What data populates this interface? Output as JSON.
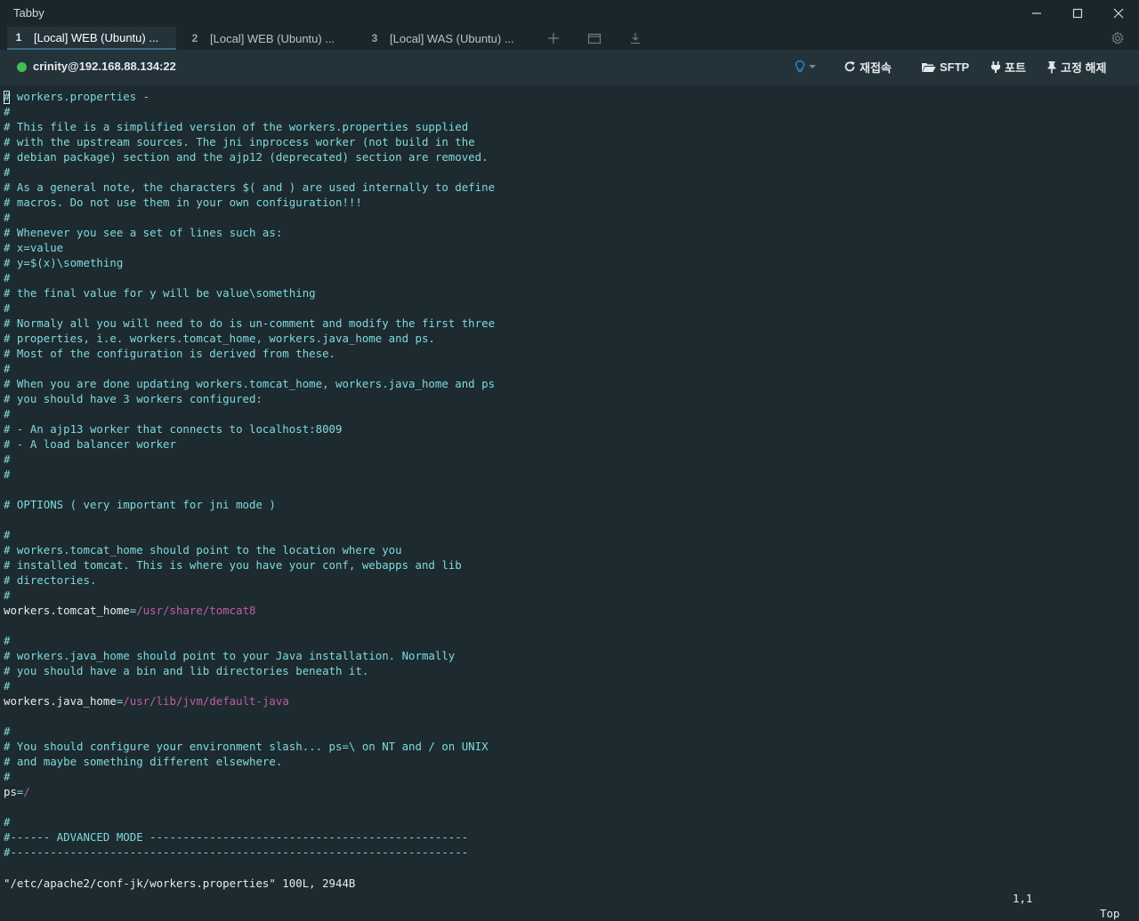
{
  "window": {
    "title": "Tabby",
    "controls": [
      "minimize-icon",
      "maximize-icon",
      "close-icon"
    ]
  },
  "tabs": [
    {
      "num": "1",
      "label": "[Local] WEB (Ubuntu) ...",
      "active": true
    },
    {
      "num": "2",
      "label": "[Local] WEB (Ubuntu) ...",
      "active": false
    },
    {
      "num": "3",
      "label": "[Local] WAS (Ubuntu) ...",
      "active": false
    }
  ],
  "tab_tools": [
    "plus-icon",
    "window-icon",
    "download-icon",
    "settings-gear-icon"
  ],
  "session": {
    "host": "crinity@192.168.88.134:22",
    "status_color": "#3fbf54",
    "reconnect_label": "재접속",
    "sftp_label": "SFTP",
    "ports_label": "포트",
    "unpin_label": "고정 해제"
  },
  "terminal": {
    "lines": [
      {
        "text": "# workers.properties -"
      },
      {
        "text": "#"
      },
      {
        "text": "# This file is a simplified version of the workers.properties supplied"
      },
      {
        "text": "# with the upstream sources. The jni inprocess worker (not build in the"
      },
      {
        "text": "# debian package) section and the ajp12 (deprecated) section are removed."
      },
      {
        "text": "#"
      },
      {
        "text": "# As a general note, the characters $( and ) are used internally to define"
      },
      {
        "text": "# macros. Do not use them in your own configuration!!!"
      },
      {
        "text": "#"
      },
      {
        "text": "# Whenever you see a set of lines such as:"
      },
      {
        "text": "# x=value"
      },
      {
        "text": "# y=$(x)\\something"
      },
      {
        "text": "#"
      },
      {
        "text": "# the final value for y will be value\\something"
      },
      {
        "text": "#"
      },
      {
        "text": "# Normaly all you will need to do is un-comment and modify the first three"
      },
      {
        "text": "# properties, i.e. workers.tomcat_home, workers.java_home and ps."
      },
      {
        "text": "# Most of the configuration is derived from these."
      },
      {
        "text": "#"
      },
      {
        "text": "# When you are done updating workers.tomcat_home, workers.java_home and ps"
      },
      {
        "text": "# you should have 3 workers configured:"
      },
      {
        "text": "#"
      },
      {
        "text": "# - An ajp13 worker that connects to localhost:8009"
      },
      {
        "text": "# - A load balancer worker"
      },
      {
        "text": "#"
      },
      {
        "text": "#"
      },
      {
        "text": ""
      },
      {
        "text": "# OPTIONS ( very important for jni mode )"
      },
      {
        "text": ""
      },
      {
        "text": "#"
      },
      {
        "text": "# workers.tomcat_home should point to the location where you"
      },
      {
        "text": "# installed tomcat. This is where you have your conf, webapps and lib"
      },
      {
        "text": "# directories."
      },
      {
        "text": "#"
      },
      {
        "key": "workers.tomcat_home",
        "eq": "=",
        "value": "/usr/share/tomcat8"
      },
      {
        "text": ""
      },
      {
        "text": "#"
      },
      {
        "text": "# workers.java_home should point to your Java installation. Normally"
      },
      {
        "text": "# you should have a bin and lib directories beneath it."
      },
      {
        "text": "#"
      },
      {
        "key": "workers.java_home",
        "eq": "=",
        "value": "/usr/lib/jvm/default-java"
      },
      {
        "text": ""
      },
      {
        "text": "#"
      },
      {
        "text": "# You should configure your environment slash... ps=\\ on NT and / on UNIX"
      },
      {
        "text": "# and maybe something different elsewhere."
      },
      {
        "text": "#"
      },
      {
        "key": "ps",
        "eq": "=",
        "value": "/"
      },
      {
        "text": ""
      },
      {
        "text": "#"
      },
      {
        "text": "#------ ADVANCED MODE ------------------------------------------------"
      },
      {
        "text": "#---------------------------------------------------------------------"
      }
    ],
    "status_file": "\"/etc/apache2/conf-jk/workers.properties\" 100L, 2944B",
    "status_pos": "1,1",
    "status_scroll": "Top"
  }
}
